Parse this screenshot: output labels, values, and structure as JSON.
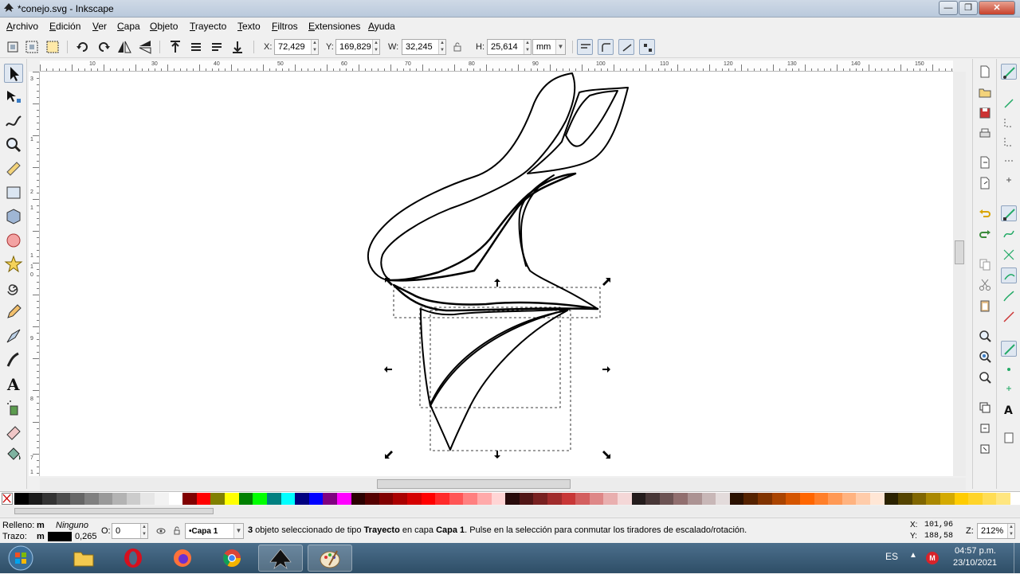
{
  "window": {
    "title": "*conejo.svg - Inkscape",
    "min": "—",
    "max": "❐",
    "close": "✕"
  },
  "menu": [
    {
      "u": "A",
      "rest": "rchivo"
    },
    {
      "u": "E",
      "rest": "dición"
    },
    {
      "u": "V",
      "rest": "er"
    },
    {
      "u": "C",
      "rest": "apa"
    },
    {
      "u": "O",
      "rest": "bjeto"
    },
    {
      "u": "T",
      "rest": "rayecto"
    },
    {
      "u": "T",
      "rest": "exto"
    },
    {
      "u": "F",
      "rest": "iltros"
    },
    {
      "u": "E",
      "rest": "xtensiones"
    },
    {
      "u": "A",
      "rest": "yuda"
    }
  ],
  "toolbar": {
    "x_label": "X:",
    "x_value": "72,429",
    "y_label": "Y:",
    "y_value": "169,829",
    "w_label": "W:",
    "w_value": "32,245",
    "h_label": "H:",
    "h_value": "25,614",
    "unit": "mm"
  },
  "rulers": {
    "h": [
      "10",
      "30",
      "40",
      "50",
      "60",
      "70",
      "80",
      "90",
      "100",
      "110",
      "120",
      "130",
      "140",
      "150"
    ],
    "v": [
      "3",
      "1",
      "2",
      "1",
      "1",
      "1",
      "0",
      "9",
      "8",
      "7",
      "1"
    ]
  },
  "statusbar": {
    "fill_label": "Relleno:",
    "fill_mark": "m",
    "fill_value": "Ninguno",
    "stroke_label": "Trazo:",
    "stroke_mark": "m",
    "stroke_width": "0,265",
    "opacity_label": "O:",
    "opacity_value": "0",
    "layer": "•Capa 1",
    "message_count": "3",
    "message_a": " objeto seleccionado de tipo ",
    "message_type": "Trayecto",
    "message_b": " en capa ",
    "message_layer": "Capa 1",
    "message_c": ". Pulse en la selección para conmutar los tiradores de escalado/rotación.",
    "cursor_x_label": "X:",
    "cursor_x": "101,96",
    "cursor_y_label": "Y:",
    "cursor_y": "188,58",
    "zoom_label": "Z:",
    "zoom": "212%"
  },
  "taskbar": {
    "lang": "ES",
    "time": "04:57 p.m.",
    "date": "23/10/2021"
  },
  "palette": [
    "#000000",
    "#1a1a1a",
    "#333333",
    "#4d4d4d",
    "#666666",
    "#808080",
    "#999999",
    "#b3b3b3",
    "#cccccc",
    "#e6e6e6",
    "#f2f2f2",
    "#ffffff",
    "#800000",
    "#ff0000",
    "#808000",
    "#ffff00",
    "#008000",
    "#00ff00",
    "#008080",
    "#00ffff",
    "#000080",
    "#0000ff",
    "#800080",
    "#ff00ff",
    "#2b0000",
    "#550000",
    "#800000",
    "#aa0000",
    "#d40000",
    "#ff0000",
    "#ff2a2a",
    "#ff5555",
    "#ff8080",
    "#ffaaaa",
    "#ffd5d5",
    "#280b0b",
    "#501616",
    "#782121",
    "#a02c2c",
    "#c83737",
    "#d35f5f",
    "#de8787",
    "#e9afaf",
    "#f4d7d7",
    "#241c1c",
    "#483737",
    "#6c5353",
    "#916f6f",
    "#ac9393",
    "#c8b7b7",
    "#e3dbdb",
    "#2b1100",
    "#552200",
    "#803300",
    "#aa4400",
    "#d45500",
    "#ff6600",
    "#ff7f2a",
    "#ff9955",
    "#ffb380",
    "#ffccaa",
    "#ffe6d5",
    "#2b2200",
    "#554400",
    "#806600",
    "#aa8800",
    "#d4aa00",
    "#ffcc00",
    "#ffd42a",
    "#ffdd55",
    "#ffe680"
  ]
}
